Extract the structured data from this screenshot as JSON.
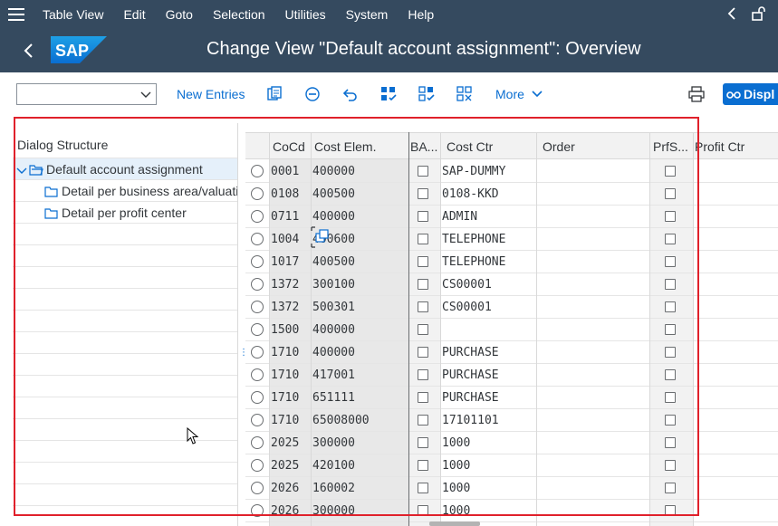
{
  "menubar": {
    "items": [
      "Table View",
      "Edit",
      "Goto",
      "Selection",
      "Utilities",
      "System",
      "Help"
    ],
    "colors": {
      "bg": "#354a5f"
    }
  },
  "titlebar": {
    "logo_text": "SAP",
    "title": "Change View \"Default account assignment\": Overview"
  },
  "toolbar": {
    "select_value": "",
    "new_entries": "New Entries",
    "more": "More",
    "display": "Displ"
  },
  "dialog": {
    "header": "Dialog Structure",
    "items": [
      {
        "label": "Default account assignment"
      },
      {
        "label": "Detail per business area/valuation"
      },
      {
        "label": "Detail per profit center"
      }
    ]
  },
  "table": {
    "columns": [
      "CoCd",
      "Cost Elem.",
      "BA...",
      "Cost Ctr",
      "Order",
      "PrfS...",
      "Profit Ctr"
    ],
    "rows": [
      {
        "cocd": "0001",
        "cost_elem": "400000",
        "cost_ctr": "SAP-DUMMY"
      },
      {
        "cocd": "0108",
        "cost_elem": "400500",
        "cost_ctr": "0108-KKD"
      },
      {
        "cocd": "0711",
        "cost_elem": "400000",
        "cost_ctr": "ADMIN"
      },
      {
        "cocd": "1004",
        "cost_elem": "400600",
        "cost_ctr": "TELEPHONE"
      },
      {
        "cocd": "1017",
        "cost_elem": "400500",
        "cost_ctr": "TELEPHONE"
      },
      {
        "cocd": "1372",
        "cost_elem": "300100",
        "cost_ctr": "CS00001"
      },
      {
        "cocd": "1372",
        "cost_elem": "500301",
        "cost_ctr": "CS00001"
      },
      {
        "cocd": "1500",
        "cost_elem": "400000",
        "cost_ctr": ""
      },
      {
        "cocd": "1710",
        "cost_elem": "400000",
        "cost_ctr": "PURCHASE"
      },
      {
        "cocd": "1710",
        "cost_elem": "417001",
        "cost_ctr": "PURCHASE"
      },
      {
        "cocd": "1710",
        "cost_elem": "651111",
        "cost_ctr": "PURCHASE"
      },
      {
        "cocd": "1710",
        "cost_elem": "65008000",
        "cost_ctr": "17101101"
      },
      {
        "cocd": "2025",
        "cost_elem": "300000",
        "cost_ctr": "1000"
      },
      {
        "cocd": "2025",
        "cost_elem": "420100",
        "cost_ctr": "1000"
      },
      {
        "cocd": "2026",
        "cost_elem": "160002",
        "cost_ctr": "1000"
      },
      {
        "cocd": "2026",
        "cost_elem": "300000",
        "cost_ctr": "1000"
      }
    ]
  },
  "colors": {
    "accent": "#0a6ed1",
    "highlight": "#e0212b"
  }
}
